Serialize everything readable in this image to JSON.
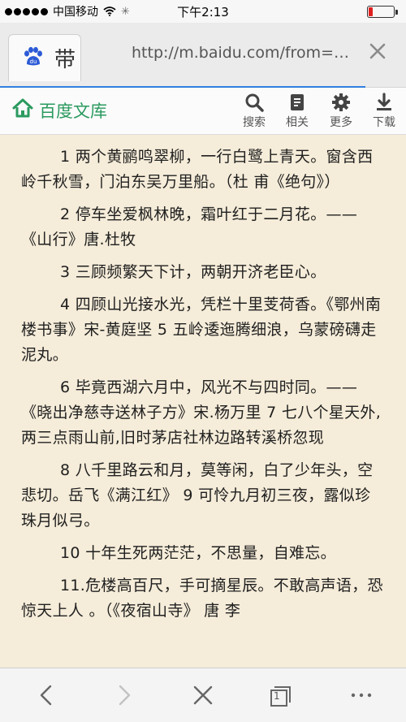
{
  "status_bar": {
    "carrier": "中国移动",
    "time": "下午2:13",
    "battery_level": 0.15
  },
  "url_bar": {
    "tab_title": "带",
    "url": "http://m.baidu.com/from=…"
  },
  "toolbar": {
    "brand": "百度文库",
    "search_label": "搜索",
    "related_label": "相关",
    "more_label": "更多",
    "download_label": "下载"
  },
  "content": {
    "paragraphs": [
      "1 两个黄鹂鸣翠柳，一行白鹭上青天。窗含西岭千秋雪，门泊东吴万里船。（杜 甫《绝句》）",
      "2 停车坐爱枫林晚，霜叶红于二月花。——《山行》唐.杜牧",
      "3 三顾频繁天下计，两朝开济老臣心。",
      "4 四顾山光接水光，凭栏十里芰荷香。《鄂州南楼书事》宋-黄庭坚 5 五岭逶迤腾细浪，乌蒙磅礴走泥丸。",
      "6 毕竟西湖六月中，风光不与四时同。——《晓出净慈寺送林子方》宋.杨万里 7 七八个星天外,两三点雨山前,旧时茅店社林边路转溪桥忽现",
      "8 八千里路云和月，莫等闲，白了少年头，空悲切。岳飞《满江红》 9 可怜九月初三夜，露似珍珠月似弓。",
      "10 十年生死两茫茫，不思量，自难忘。",
      "11.危楼高百尺，手可摘星辰。不敢高声语，恐惊天上人 。（《夜宿山寺》 唐 李"
    ]
  },
  "bottom_bar": {
    "tab_count": "1"
  },
  "colors": {
    "page_background": "#f5ecd9",
    "brand_green": "#2b9a5f",
    "progress_blue": "#2f7fe0",
    "battery_red": "#e02020"
  }
}
